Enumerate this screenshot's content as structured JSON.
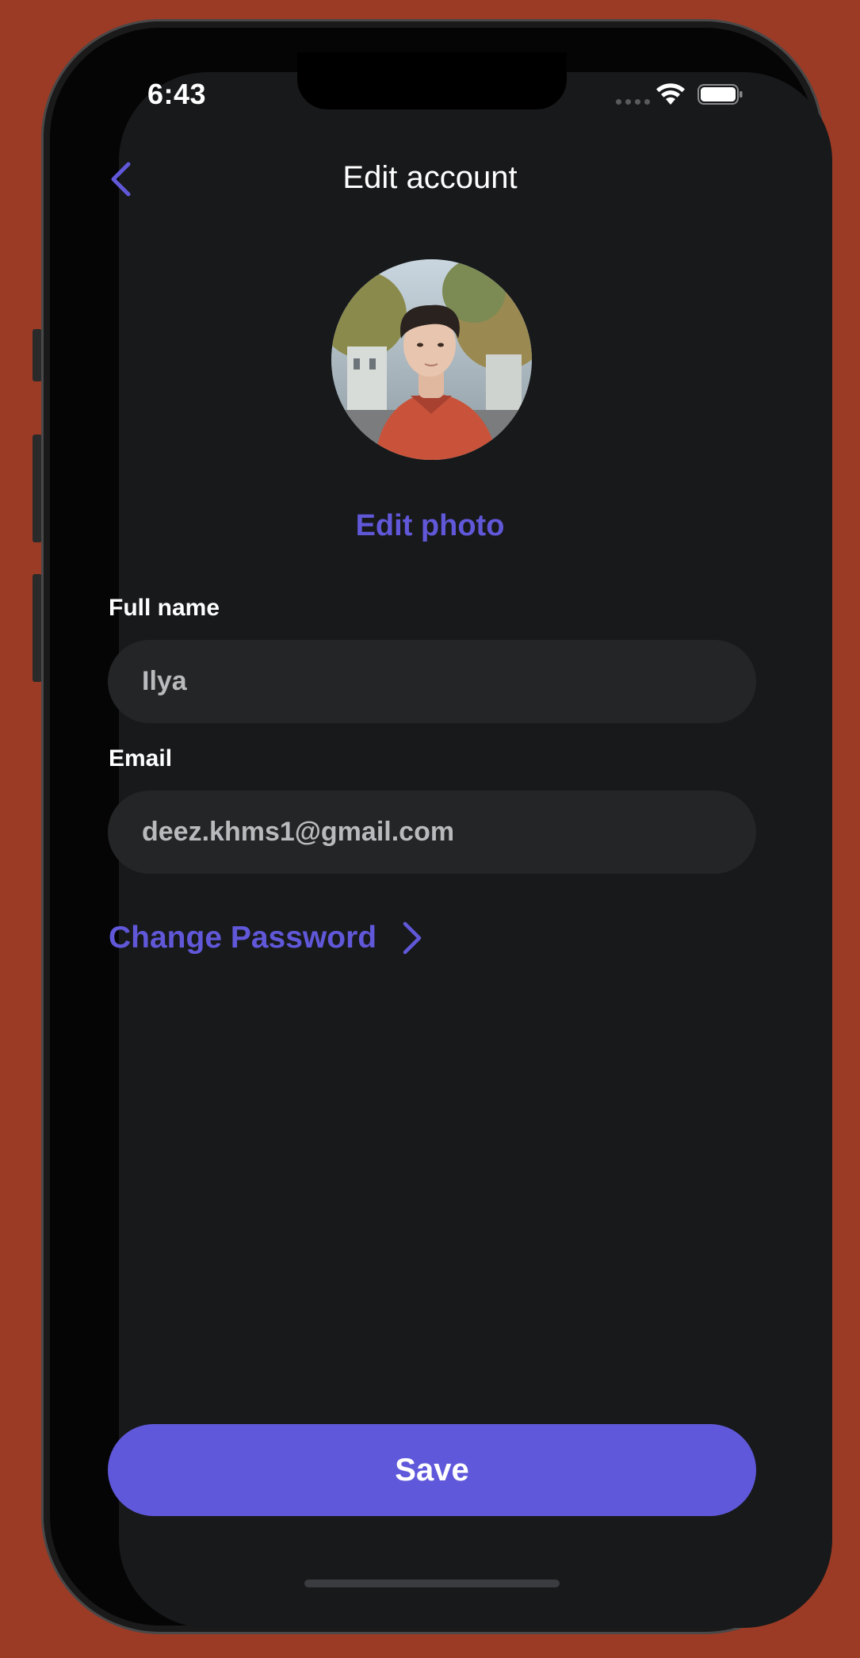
{
  "status_bar": {
    "time": "6:43"
  },
  "header": {
    "title": "Edit account",
    "back_icon": "chevron-left-icon"
  },
  "profile": {
    "edit_photo_label": "Edit photo"
  },
  "form": {
    "full_name": {
      "label": "Full name",
      "value": "Ilya"
    },
    "email": {
      "label": "Email",
      "value": "deez.khms1@gmail.com"
    }
  },
  "change_password": {
    "label": "Change Password",
    "icon": "chevron-right-icon"
  },
  "save_button": {
    "label": "Save"
  },
  "colors": {
    "accent": "#5f58da",
    "background": "#18191b",
    "field_background": "#242527",
    "frame_background": "#9c3b25"
  }
}
